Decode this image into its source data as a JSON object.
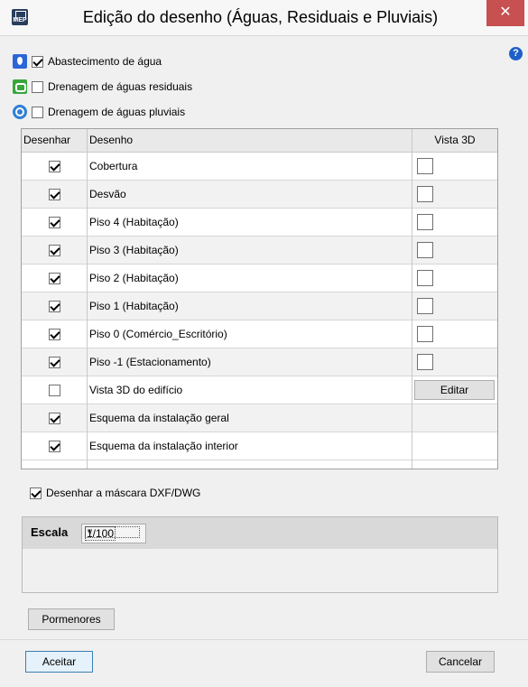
{
  "window": {
    "title": "Edição do desenho (Águas, Residuais e Pluviais)",
    "icon_text": "MEP",
    "close_glyph": "✕",
    "help_glyph": "?"
  },
  "networks": [
    {
      "icon": "water-drop-icon",
      "label": "Abastecimento de água",
      "checked": true
    },
    {
      "icon": "wastewater-icon",
      "label": "Drenagem de águas residuais",
      "checked": false
    },
    {
      "icon": "rainwater-icon",
      "label": "Drenagem de águas pluviais",
      "checked": false
    }
  ],
  "grid": {
    "columns": [
      "Desenhar",
      "Desenho",
      "Vista 3D"
    ],
    "rows": [
      {
        "draw": true,
        "name": "Cobertura",
        "view3d": "checkbox"
      },
      {
        "draw": true,
        "name": "Desvão",
        "view3d": "checkbox"
      },
      {
        "draw": true,
        "name": "Piso 4 (Habitação)",
        "view3d": "checkbox"
      },
      {
        "draw": true,
        "name": "Piso 3 (Habitação)",
        "view3d": "checkbox"
      },
      {
        "draw": true,
        "name": "Piso 2 (Habitação)",
        "view3d": "checkbox"
      },
      {
        "draw": true,
        "name": "Piso 1 (Habitação)",
        "view3d": "checkbox"
      },
      {
        "draw": true,
        "name": "Piso 0 (Comércio_Escritório)",
        "view3d": "checkbox"
      },
      {
        "draw": true,
        "name": "Piso -1 (Estacionamento)",
        "view3d": "checkbox"
      },
      {
        "draw": false,
        "name": "Vista 3D do edifício",
        "view3d": "button"
      },
      {
        "draw": true,
        "name": "Esquema da instalação geral",
        "view3d": "none"
      },
      {
        "draw": true,
        "name": "Esquema da instalação interior",
        "view3d": "none"
      }
    ],
    "edit_label": "Editar"
  },
  "mask": {
    "label": "Desenhar a máscara DXF/DWG",
    "checked": true
  },
  "scale": {
    "label": "Escala",
    "value": "1/100",
    "arrow": "∨"
  },
  "buttons": {
    "details": "Pormenores",
    "accept": "Aceitar",
    "cancel": "Cancelar"
  }
}
